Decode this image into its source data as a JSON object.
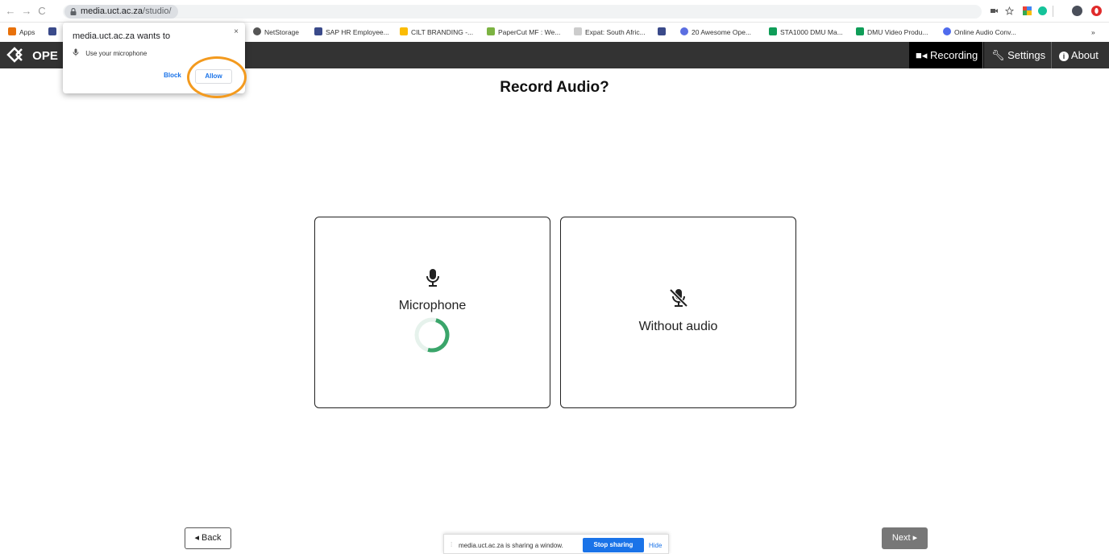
{
  "browser": {
    "url_host": "media.uct.ac.za",
    "url_path": "/studio/",
    "nav": {
      "back": "←",
      "forward": "→",
      "reload": "C"
    }
  },
  "bookmarks": {
    "items": [
      {
        "label": "Apps",
        "color": "#e8710a"
      },
      {
        "label": "NetStorage",
        "color": "#555555"
      },
      {
        "label": "SAP HR Employee...",
        "color": "#3a4a8a"
      },
      {
        "label": "CILT BRANDING -...",
        "color": "#fbbc04"
      },
      {
        "label": "PaperCut MF : We...",
        "color": "#7cb342"
      },
      {
        "label": "Expat: South Afric...",
        "color": "#cccccc"
      },
      {
        "label": "",
        "color": "#3a4a8a"
      },
      {
        "label": "20 Awesome Ope...",
        "color": "#5b6ee1"
      },
      {
        "label": "STA1000 DMU Ma...",
        "color": "#0f9d58"
      },
      {
        "label": "DMU Video Produ...",
        "color": "#0f9d58"
      },
      {
        "label": "Online Audio Conv...",
        "color": "#4f6bed"
      }
    ],
    "more": "»"
  },
  "app": {
    "logo_text": "OPE",
    "nav": {
      "recording": "Recording",
      "settings": "Settings",
      "about": "About"
    }
  },
  "permission_popup": {
    "title": "media.uct.ac.za wants to",
    "request": "Use your microphone",
    "block": "Block",
    "allow": "Allow",
    "close": "×"
  },
  "main": {
    "title": "Record Audio?",
    "option_microphone": "Microphone",
    "option_without": "Without audio",
    "back": "◂ Back",
    "next": "Next ▸",
    "spinner_progress": 0.35
  },
  "share_bar": {
    "grip": "⁞",
    "text": "media.uct.ac.za is sharing a window.",
    "stop": "Stop sharing",
    "hide": "Hide"
  },
  "colors": {
    "accent_ring": "#f39a1e",
    "spinner": "#3aa56a",
    "link": "#1a73e8"
  }
}
